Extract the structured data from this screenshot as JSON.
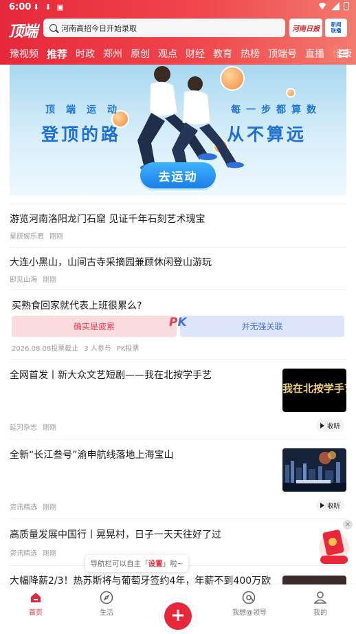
{
  "status_bar": {
    "time": "6:00"
  },
  "header": {
    "logo": "顶端",
    "search_placeholder": "河南高招今日开始录取",
    "paper_logo": "河南日报",
    "live_label_1": "新闻",
    "live_label_2": "联播"
  },
  "channels": [
    "豫视频",
    "推荐",
    "时政",
    "郑州",
    "原创",
    "观点",
    "财经",
    "教育",
    "热榜",
    "顶端号",
    "直播",
    "健康"
  ],
  "active_channel": "推荐",
  "banner": {
    "left_top": "顶端运动",
    "left_big": "登顶的路",
    "right_top": "每一步都算数",
    "right_big": "从不算远",
    "button": "去运动"
  },
  "feed": [
    {
      "title": "游览河南洛阳龙门石窟 见证千年石刻艺术瑰宝",
      "source": "星辰娱乐君",
      "time": "刚刚"
    },
    {
      "title": "大连小黑山，山间古寺采摘园兼顾休闲登山游玩",
      "source": "即见山海",
      "time": "刚刚"
    },
    {
      "title": "全网首发丨新大众文艺短剧——我在北按学手艺",
      "source": "延河杂志",
      "time": "刚刚",
      "thumb_text": "我在北按学手艺",
      "listen": "收听"
    },
    {
      "title": "全新“长江叁号”渝申航线落地上海宝山",
      "source": "资讯精选",
      "time": "刚刚",
      "listen": "收听"
    },
    {
      "title": "高质量发展中国行丨晃晃村，日子一天天往好了过",
      "source": "资讯精选",
      "time": "刚刚"
    },
    {
      "title": "大幅降薪2/3！热苏斯将与葡萄牙签约4年，年薪不到400万欧"
    }
  ],
  "poll": {
    "question": "买熟食回家就代表上班很累么?",
    "option_a": "确实是疲累",
    "option_b": "并无强关联",
    "deadline": "2026.08.08投票截止",
    "participants": "3 人参与",
    "type": "PK投票"
  },
  "tooltip": {
    "before": "导航栏可以自主「",
    "highlight": "设置",
    "after": "」啦~"
  },
  "bottom_nav": [
    {
      "label": "首页",
      "active": true
    },
    {
      "label": "生活"
    },
    {
      "label": "我想@领导"
    },
    {
      "label": "我的"
    }
  ],
  "colors": {
    "brand_red": "#e12b3a",
    "header_gradient_end": "#f27a6e",
    "poll_red": "#e34255",
    "poll_blue": "#4870d8"
  }
}
